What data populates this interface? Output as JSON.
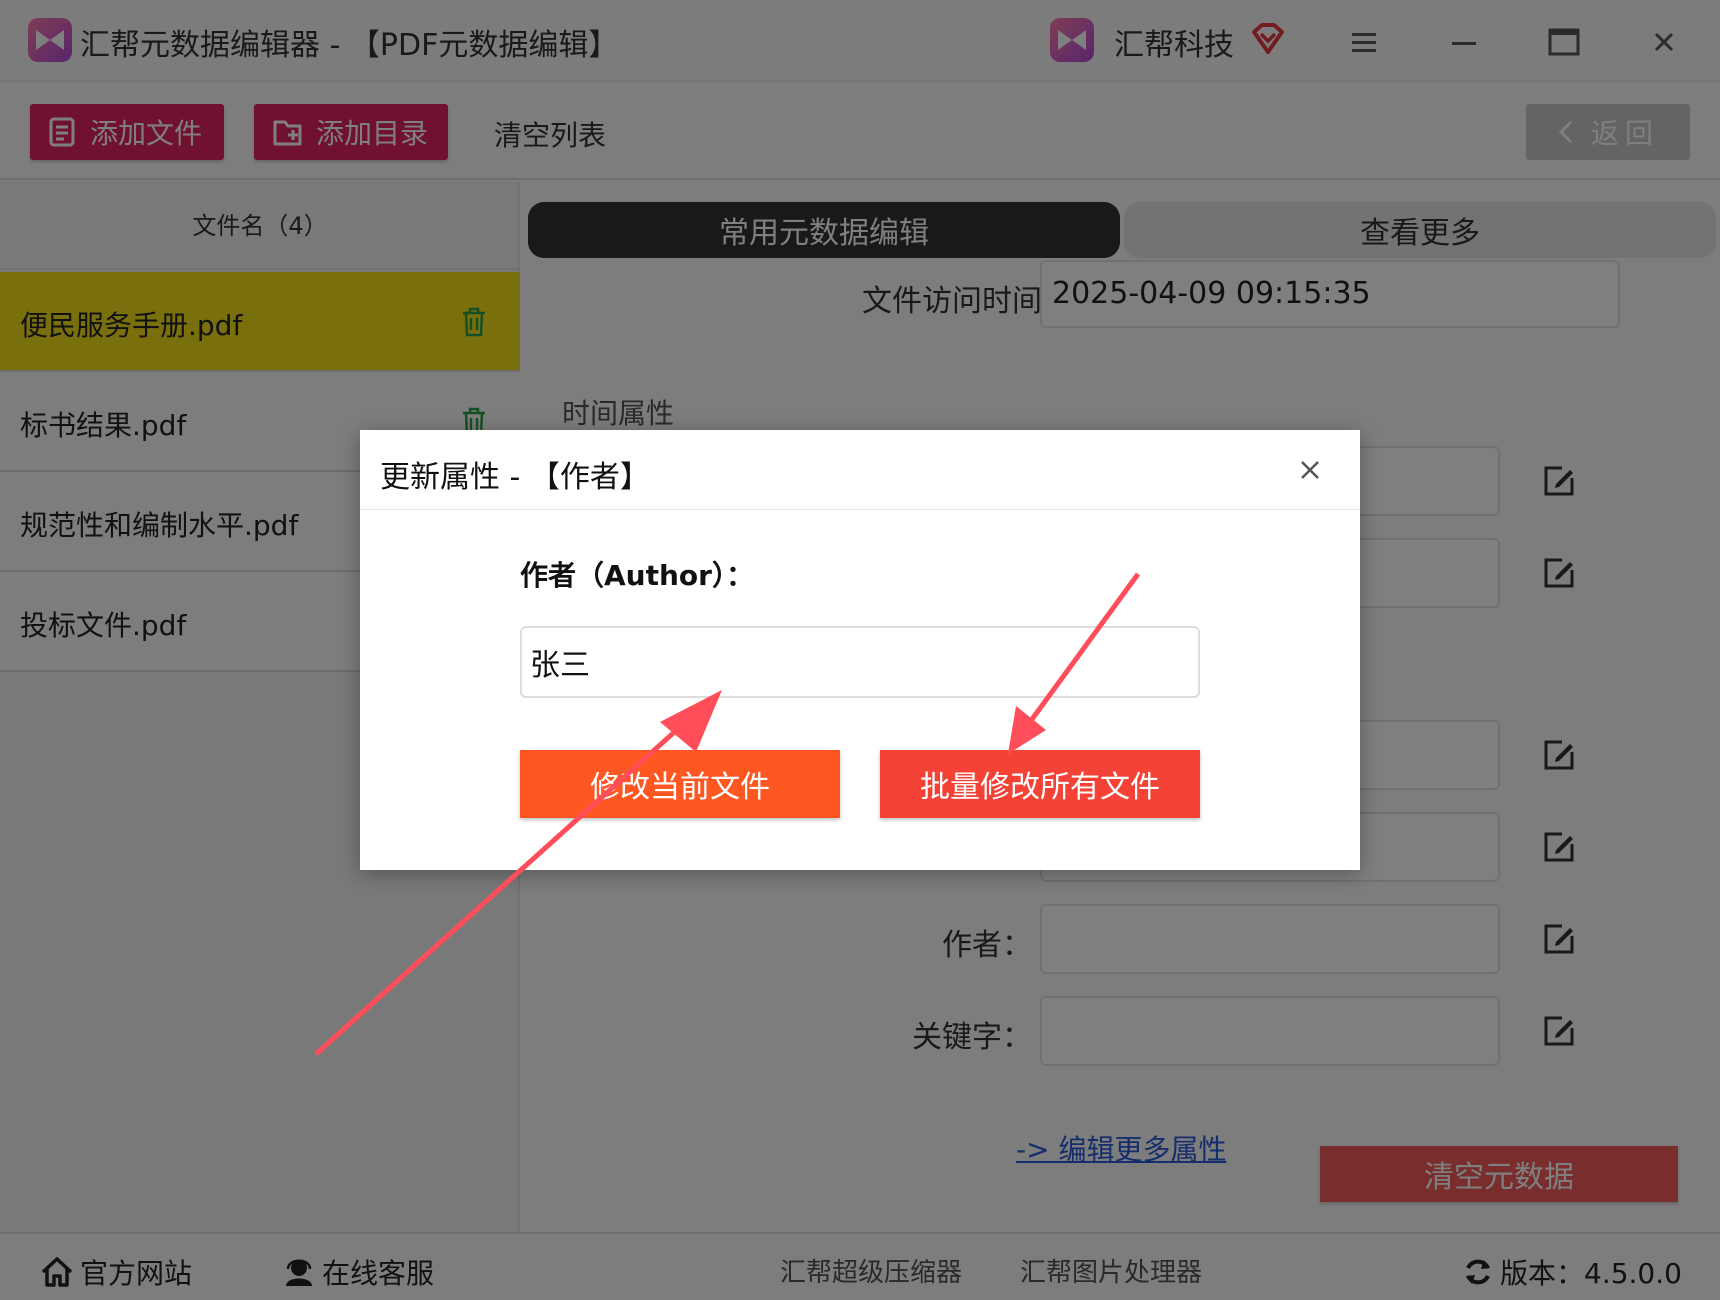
{
  "window": {
    "title": "汇帮元数据编辑器 - 【PDF元数据编辑】",
    "brand": "汇帮科技"
  },
  "toolbar": {
    "add_file": "添加文件",
    "add_folder": "添加目录",
    "clear_list": "清空列表",
    "back": "返回"
  },
  "file_list": {
    "header": "文件名（4）",
    "files": [
      {
        "name": "便民服务手册.pdf"
      },
      {
        "name": "标书结果.pdf"
      },
      {
        "name": "规范性和编制水平.pdf"
      },
      {
        "name": "投标文件.pdf"
      }
    ]
  },
  "tabs": {
    "common": "常用元数据编辑",
    "more": "查看更多"
  },
  "fields": {
    "access_time_label": "文件访问时间",
    "access_time_value": "2025-04-09 09:15:35",
    "section_time": "时间属性",
    "author_label": "作者：",
    "keywords_label": "关键字："
  },
  "links": {
    "edit_more": "-> 编辑更多属性"
  },
  "buttons": {
    "clear_metadata": "清空元数据"
  },
  "bottom": {
    "website": "官方网站",
    "support": "在线客服",
    "compressor": "汇帮超级压缩器",
    "image_tool": "汇帮图片处理器",
    "version": "版本：4.5.0.0"
  },
  "dialog": {
    "title": "更新属性 - 【作者】",
    "field_label": "作者（Author）：",
    "input_value": "张三",
    "btn_current": "修改当前文件",
    "btn_batch": "批量修改所有文件"
  },
  "colors": {
    "accent": "#e0245e",
    "highlight": "#f2e01b",
    "btn_orange": "#ff5722",
    "btn_red": "#f44336",
    "arrow": "#ff4d5a"
  }
}
